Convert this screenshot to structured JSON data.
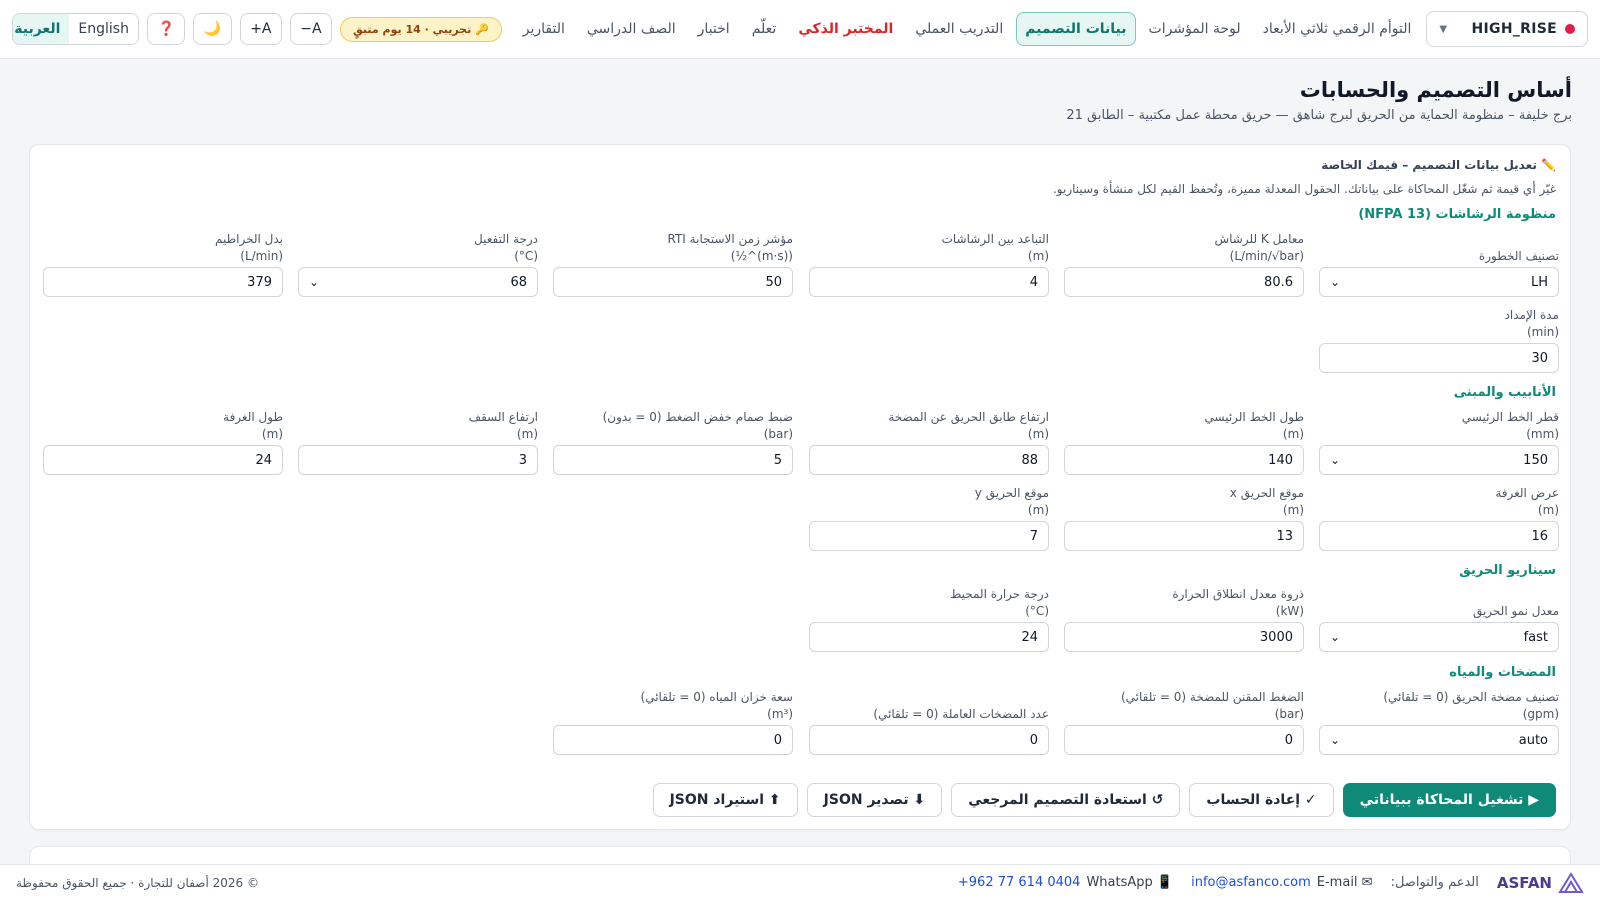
{
  "project": {
    "name": "HIGH_RISE",
    "status_color": "#e11d48"
  },
  "nav": [
    {
      "label": "التوأم الرقمي ثلاثي الأبعاد"
    },
    {
      "label": "لوحة المؤشرات"
    },
    {
      "label": "بيانات التصميم"
    },
    {
      "label": "التدريب العملي"
    },
    {
      "label": "المختبر الذكي"
    },
    {
      "label": "تعلّم"
    },
    {
      "label": "اختبار"
    },
    {
      "label": "الصف الدراسي"
    },
    {
      "label": "التقارير"
    }
  ],
  "trial_badge": "🔑 تجريبي · 14 يوم متبقٍ",
  "toolbar": {
    "font_decrease": "A−",
    "font_increase": "A+",
    "dark_mode": "🌙",
    "help": "❓"
  },
  "languages": {
    "english": "English",
    "arabic": "العربية",
    "active": "العربية"
  },
  "page": {
    "title": "أساس التصميم والحسابات",
    "subtitle": "برج خليفة – منظومة الحماية من الحريق لبرج شاهق — حريق محطة عمل مكتبية – الطابق 21"
  },
  "card": {
    "title": "✏️ تعديل بيانات التصميم – قيمك الخاصة",
    "description": "غيّر أي قيمة ثم شغّل المحاكاة على بياناتك. الحقول المعدلة مميزة، وتُحفظ القيم لكل منشأة وسيناريو."
  },
  "sections": {
    "sprinklers": "منظومة الرشاشات (NFPA 13)",
    "piping": "الأنابيب والمبنى",
    "scenario": "سيناريو الحريق",
    "pumps": "المضخات والمياه"
  },
  "fields": {
    "hazard": {
      "label1": "تصنيف الخطورة",
      "label2": "",
      "value": "LH"
    },
    "k_factor": {
      "label1": "معامل K للرشاش",
      "label2": "(L/min/√bar)",
      "value": "80.6"
    },
    "spacing": {
      "label1": "التباعد بين الرشاشات",
      "label2": "(m)",
      "value": "4"
    },
    "rti": {
      "label1": "مؤشر زمن الاستجابة RTI",
      "label2": "((m·s)^½)",
      "value": "50"
    },
    "activation_temp": {
      "label1": "درجة التفعيل",
      "label2": "(C°)",
      "value": "68"
    },
    "hose_allowance": {
      "label1": "بدل الخراطيم",
      "label2": "(L/min)",
      "value": "379"
    },
    "supply_duration": {
      "label1": "مدة الإمداد",
      "label2": "(min)",
      "value": "30"
    },
    "main_diameter": {
      "label1": "قطر الخط الرئيسي",
      "label2": "(mm)",
      "value": "150"
    },
    "main_length": {
      "label1": "طول الخط الرئيسي",
      "label2": "(m)",
      "value": "140"
    },
    "floor_height": {
      "label1": "ارتفاع طابق الحريق عن المضخة",
      "label2": "(m)",
      "value": "88"
    },
    "prv_setting": {
      "label1": "ضبط صمام خفض الضغط (0 = بدون)",
      "label2": "(bar)",
      "value": "5"
    },
    "ceiling_height": {
      "label1": "ارتفاع السقف",
      "label2": "(m)",
      "value": "3"
    },
    "room_length": {
      "label1": "طول الغرفة",
      "label2": "(m)",
      "value": "24"
    },
    "room_width": {
      "label1": "عرض الغرفة",
      "label2": "(m)",
      "value": "16"
    },
    "fire_x": {
      "label1": "موقع الحريق x",
      "label2": "(m)",
      "value": "13"
    },
    "fire_y": {
      "label1": "موقع الحريق y",
      "label2": "(m)",
      "value": "7"
    },
    "growth_rate": {
      "label1": "معدل نمو الحريق",
      "label2": "",
      "value": "fast"
    },
    "peak_hrr": {
      "label1": "ذروة معدل انطلاق الحرارة",
      "label2": "(kW)",
      "value": "3000"
    },
    "ambient_temp": {
      "label1": "درجة حرارة المحيط",
      "label2": "(C°)",
      "value": "24"
    },
    "pump_rating": {
      "label1": "تصنيف مضخة الحريق (0 = تلقائي)",
      "label2": "(gpm)",
      "value": "auto"
    },
    "pump_pressure": {
      "label1": "الضغط المقنن للمضخة (0 = تلقائي)",
      "label2": "(bar)",
      "value": "0"
    },
    "duty_pumps": {
      "label1": "",
      "label2": "عدد المضخات العاملة (0 = تلقائي)",
      "value": "0"
    },
    "tank_capacity": {
      "label1": "سعة خزان المياه (0 = تلقائي)",
      "label2": "(m³)",
      "value": "0"
    }
  },
  "actions": {
    "run": "▶ تشغيل المحاكاة ببياناتي",
    "recalc": "✓ إعادة الحساب",
    "restore": "↺ استعادة التصميم المرجعي",
    "export": "⬇ تصدير JSON",
    "import": "⬆ استيراد JSON"
  },
  "footer": {
    "brand": "ASFAN",
    "support": "الدعم والتواصل:",
    "email_label": "✉ E-mail",
    "email": "info@asfanco.com",
    "whatsapp_label": "📱 WhatsApp",
    "whatsapp": "+962 77 614 0404",
    "copyright": "© 2026 أصفان للتجارة · جميع الحقوق محفوظة"
  }
}
